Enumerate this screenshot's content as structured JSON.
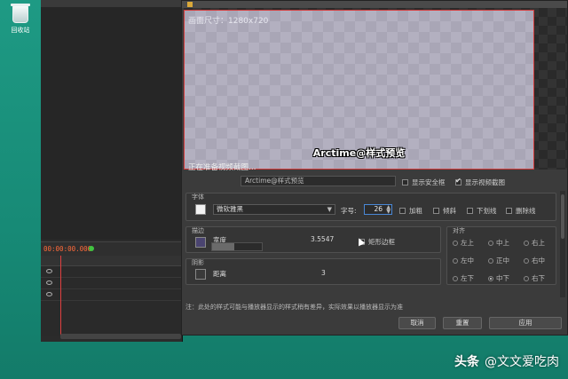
{
  "desktop": {
    "recycle_label": "回收站"
  },
  "editor": {
    "timecode": "00:00:00.000"
  },
  "dialog": {
    "canvas_size": "画面尺寸：1280x720",
    "preview_text": "Arctime@样式预览",
    "loading": "正在准备视频截图…",
    "preview_input": "Arctime@样式预览",
    "show_safe_frame": "显示安全框",
    "show_video_snapshot": "显示视频截图",
    "font_group": "字体",
    "font_name": "微软雅黑",
    "font_size_label": "字号:",
    "font_size": "26",
    "bold": "加粗",
    "italic": "倾斜",
    "underline": "下划线",
    "strikethrough": "删除线",
    "stroke_group": "描边",
    "width_label": "宽度",
    "width_value": "3.5547",
    "rect_border": "矩形边框",
    "shadow_group": "阴影",
    "distance_label": "距离",
    "distance_value": "3",
    "width_fill_pct": 45,
    "align_group": "对齐",
    "align": [
      "左上",
      "中上",
      "右上",
      "左中",
      "正中",
      "右中",
      "左下",
      "中下",
      "右下"
    ],
    "note": "注：此处的样式可能与播放器显示的样式稍有差异，实际效果以播放器显示为准",
    "cancel": "取消",
    "reset": "重置",
    "apply": "应用"
  },
  "watermark": {
    "prefix": "头条",
    "handle": "@文文爱吃肉"
  },
  "colors": {
    "desktop": "#1e9a84",
    "accent_stroke": "#d23a3a",
    "timecode": "#ff6a3a"
  }
}
